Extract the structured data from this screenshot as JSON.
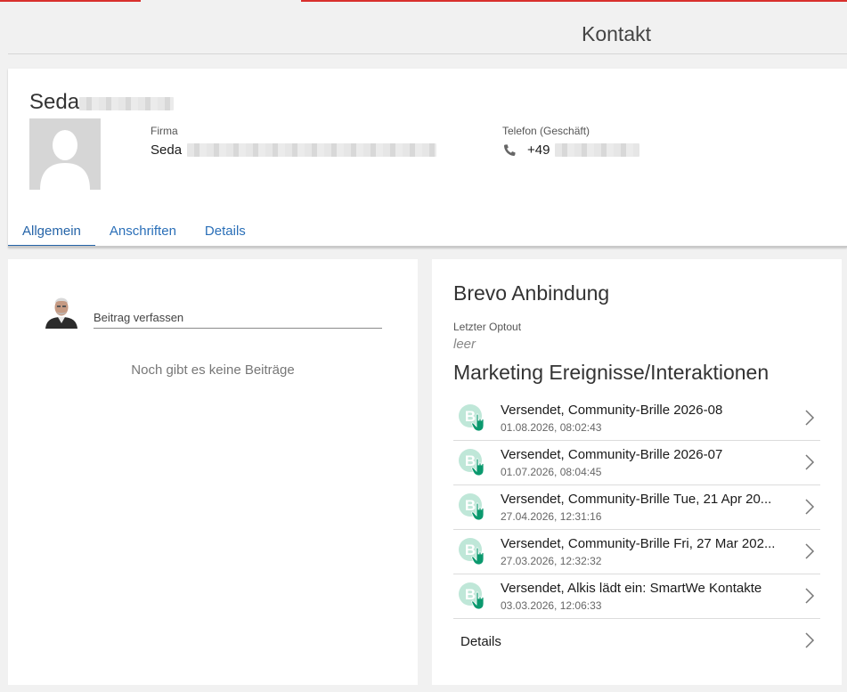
{
  "page": {
    "title": "Kontakt"
  },
  "contact": {
    "first_name": "Seda",
    "company_label": "Firma",
    "company_value": "Seda",
    "phone_label": "Telefon (Geschäft)",
    "phone_value": "+49"
  },
  "tabs": [
    {
      "label": "Allgemein",
      "active": true
    },
    {
      "label": "Anschriften",
      "active": false
    },
    {
      "label": "Details",
      "active": false
    }
  ],
  "feed": {
    "post_placeholder": "Beitrag verfassen",
    "empty_text": "Noch gibt es keine Beiträge"
  },
  "brevo": {
    "title": "Brevo Anbindung",
    "optout_label": "Letzter Optout",
    "optout_value": "leer",
    "marketing_title": "Marketing Ereignisse/Interaktionen",
    "events": [
      {
        "title": "Versendet, Community-Brille 2026-08",
        "date": "01.08.2026, 08:02:43"
      },
      {
        "title": "Versendet, Community-Brille 2026-07",
        "date": "01.07.2026, 08:04:45"
      },
      {
        "title": "Versendet, Community-Brille Tue, 21 Apr 20...",
        "date": "27.04.2026, 12:31:16"
      },
      {
        "title": "Versendet, Community-Brille Fri, 27 Mar 202...",
        "date": "27.03.2026, 12:32:32"
      },
      {
        "title": "Versendet, Alkis lädt ein: SmartWe Kontakte",
        "date": "03.03.2026, 12:06:33"
      }
    ],
    "details_label": "Details"
  },
  "icons": {
    "event_icon": "brevo-click-icon",
    "chevron": "chevron-right-icon",
    "phone": "phone-icon"
  },
  "colors": {
    "accent_red": "#d9302d",
    "tab_blue": "#2564a8",
    "brevo_green": "#0b996e"
  }
}
